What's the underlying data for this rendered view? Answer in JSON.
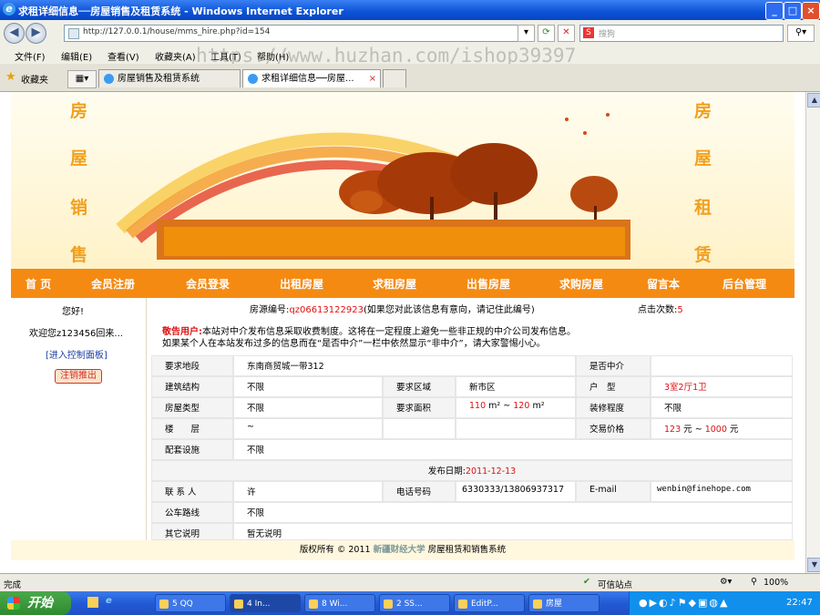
{
  "window": {
    "title": "求租详细信息──房屋销售及租赁系统 - Windows Internet Explorer"
  },
  "address": {
    "url": "http://127.0.0.1/house/mms_hire.php?id=154"
  },
  "search": {
    "placeholder": "搜狗"
  },
  "menus": [
    "文件(F)",
    "编辑(E)",
    "查看(V)",
    "收藏夹(A)",
    "工具(T)",
    "帮助(H)"
  ],
  "watermark": "https://www.huzhan.com/ishop39397",
  "favorites": {
    "label": "收藏夹"
  },
  "tabs": [
    {
      "label": "房屋销售及租赁系统"
    },
    {
      "label": "求租详细信息──房屋..."
    }
  ],
  "banner": {
    "left_chars": [
      "房",
      "屋",
      "销",
      "售"
    ],
    "right_chars": [
      "房",
      "屋",
      "租",
      "赁"
    ]
  },
  "nav": [
    "首 页",
    "会员注册",
    "会员登录",
    "出租房屋",
    "求租房屋",
    "出售房屋",
    "求购房屋",
    "留言本",
    "后台管理"
  ],
  "sidebar": {
    "greeting": "您好!",
    "welcome": "欢迎您z123456回来...",
    "control_panel": "[进入控制面板]",
    "logout": "注销推出"
  },
  "detail": {
    "source_label": "房源编号:",
    "source_code": "qz06613122923",
    "source_note": "(如果您对此该信息有意向，请记住此编号)",
    "clicks_label": "点击次数:",
    "clicks": "5",
    "notice_title": "敬告用户:",
    "notice_1": "本站对中介发布信息采取收费制度。这将在一定程度上避免一些非正规的中介公司发布信息。",
    "notice_2": "如果某个人在本站发布过多的信息而在“是否中介”一栏中依然显示“非中介”，请大家警惕小心。",
    "location_label": "要求地段",
    "location": "东南商贸城一带312",
    "agent_label": "是否中介",
    "agent": "",
    "structure_label": "建筑结构",
    "structure": "不限",
    "area_region_label": "要求区域",
    "area_region": "新市区",
    "layout_label": "户　型",
    "layout": "3室2厅1卫",
    "type_label": "房屋类型",
    "type": "不限",
    "size_label": "要求面积",
    "size_min": "110",
    "size_max": "120",
    "size_unit": "m²",
    "tilde": "~",
    "decor_label": "装修程度",
    "decor": "不限",
    "floor_label": "楼　　层",
    "floor": "~",
    "price_label": "交易价格",
    "price_min": "123",
    "price_max": "1000",
    "price_unit": "元",
    "facility_label": "配套设施",
    "facility": "不限",
    "date_label": "发布日期:",
    "date": "2011-12-13",
    "contact_label": "联 系 人",
    "contact": "许",
    "phone_label": "电话号码",
    "phone": "6330333/13806937317",
    "email_label": "E-mail",
    "email": "wenbin@finehope.com",
    "bus_label": "公车路线",
    "bus": "不限",
    "other_label": "其它说明",
    "other": "暂无说明"
  },
  "footer": {
    "text_1": "版权所有 © 2011",
    "school": "新疆财经大学",
    "text_2": "房屋租赁和销售系统"
  },
  "status": {
    "left": "完成",
    "zone": "可信站点",
    "zoom": "100%"
  },
  "taskbar": {
    "start": "开始",
    "tasks": [
      "5 QQ",
      "4 In...",
      "8 Wi...",
      "2 SS...",
      "EditP...",
      "房屋"
    ],
    "clock": "22:47"
  },
  "colors": {
    "accent": "#f58a12",
    "title_blue": "#0b52d6",
    "price_red": "#d11111"
  }
}
